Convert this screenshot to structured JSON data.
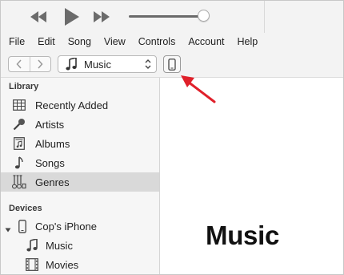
{
  "colors": {
    "chrome_bg": "#f3f3f3",
    "sidebar_bg": "#f6f6f6",
    "selected_row": "#d9d9d9",
    "annotation_arrow": "#e0202a"
  },
  "playback": {
    "rewind_icon": "rewind-icon",
    "play_icon": "play-icon",
    "forward_icon": "fast-forward-icon",
    "volume_level": 0.9
  },
  "menu": [
    "File",
    "Edit",
    "Song",
    "View",
    "Controls",
    "Account",
    "Help"
  ],
  "nav": {
    "back_icon": "chevron-left-icon",
    "forward_icon": "chevron-right-icon",
    "media_type": "Music",
    "device_icon": "iphone-icon"
  },
  "sidebar": {
    "library_title": "Library",
    "library_items": [
      {
        "label": "Recently Added",
        "icon": "recently-added-icon"
      },
      {
        "label": "Artists",
        "icon": "microphone-icon"
      },
      {
        "label": "Albums",
        "icon": "albums-icon"
      },
      {
        "label": "Songs",
        "icon": "music-note-icon"
      },
      {
        "label": "Genres",
        "icon": "guitar-icon",
        "selected": true
      }
    ],
    "devices_title": "Devices",
    "device": {
      "label": "Cop's iPhone",
      "icon": "iphone-icon",
      "expanded": true
    },
    "device_items": [
      {
        "label": "Music",
        "icon": "music-note-icon"
      },
      {
        "label": "Movies",
        "icon": "film-icon"
      }
    ]
  },
  "content": {
    "title": "Music"
  }
}
